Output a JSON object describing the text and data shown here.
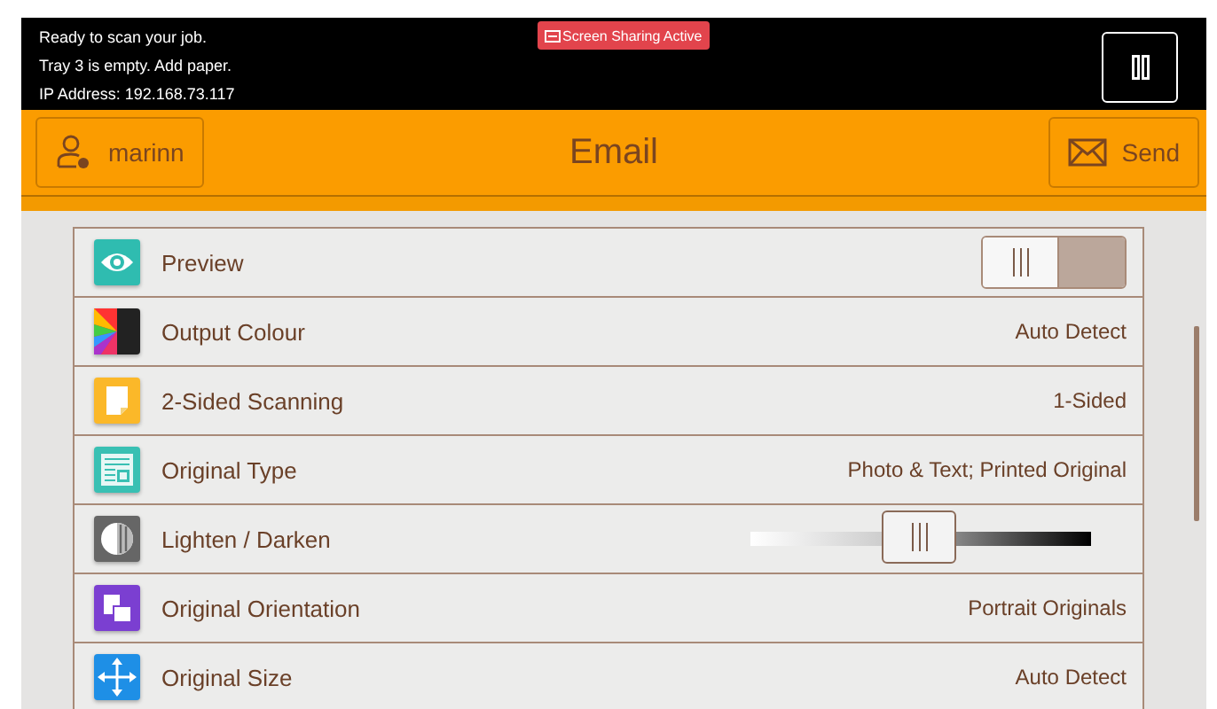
{
  "status_bar": {
    "messages": [
      "Ready to scan your job.",
      "Tray 3 is empty.  Add paper.",
      "IP Address: 192.168.73.117"
    ],
    "badge": "Screen Sharing Active"
  },
  "header": {
    "user": "marinn",
    "title": "Email",
    "send": "Send"
  },
  "settings": [
    {
      "kind": "toggle",
      "label": "Preview",
      "on": false
    },
    {
      "kind": "value",
      "label": "Output Colour",
      "value": "Auto Detect"
    },
    {
      "kind": "value",
      "label": "2-Sided Scanning",
      "value": "1-Sided"
    },
    {
      "kind": "value",
      "label": "Original Type",
      "value": "Photo & Text; Printed Original"
    },
    {
      "kind": "slider",
      "label": "Lighten / Darken",
      "level": 0.5
    },
    {
      "kind": "value",
      "label": "Original Orientation",
      "value": "Portrait Originals"
    },
    {
      "kind": "value",
      "label": "Original Size",
      "value": "Auto Detect"
    }
  ]
}
